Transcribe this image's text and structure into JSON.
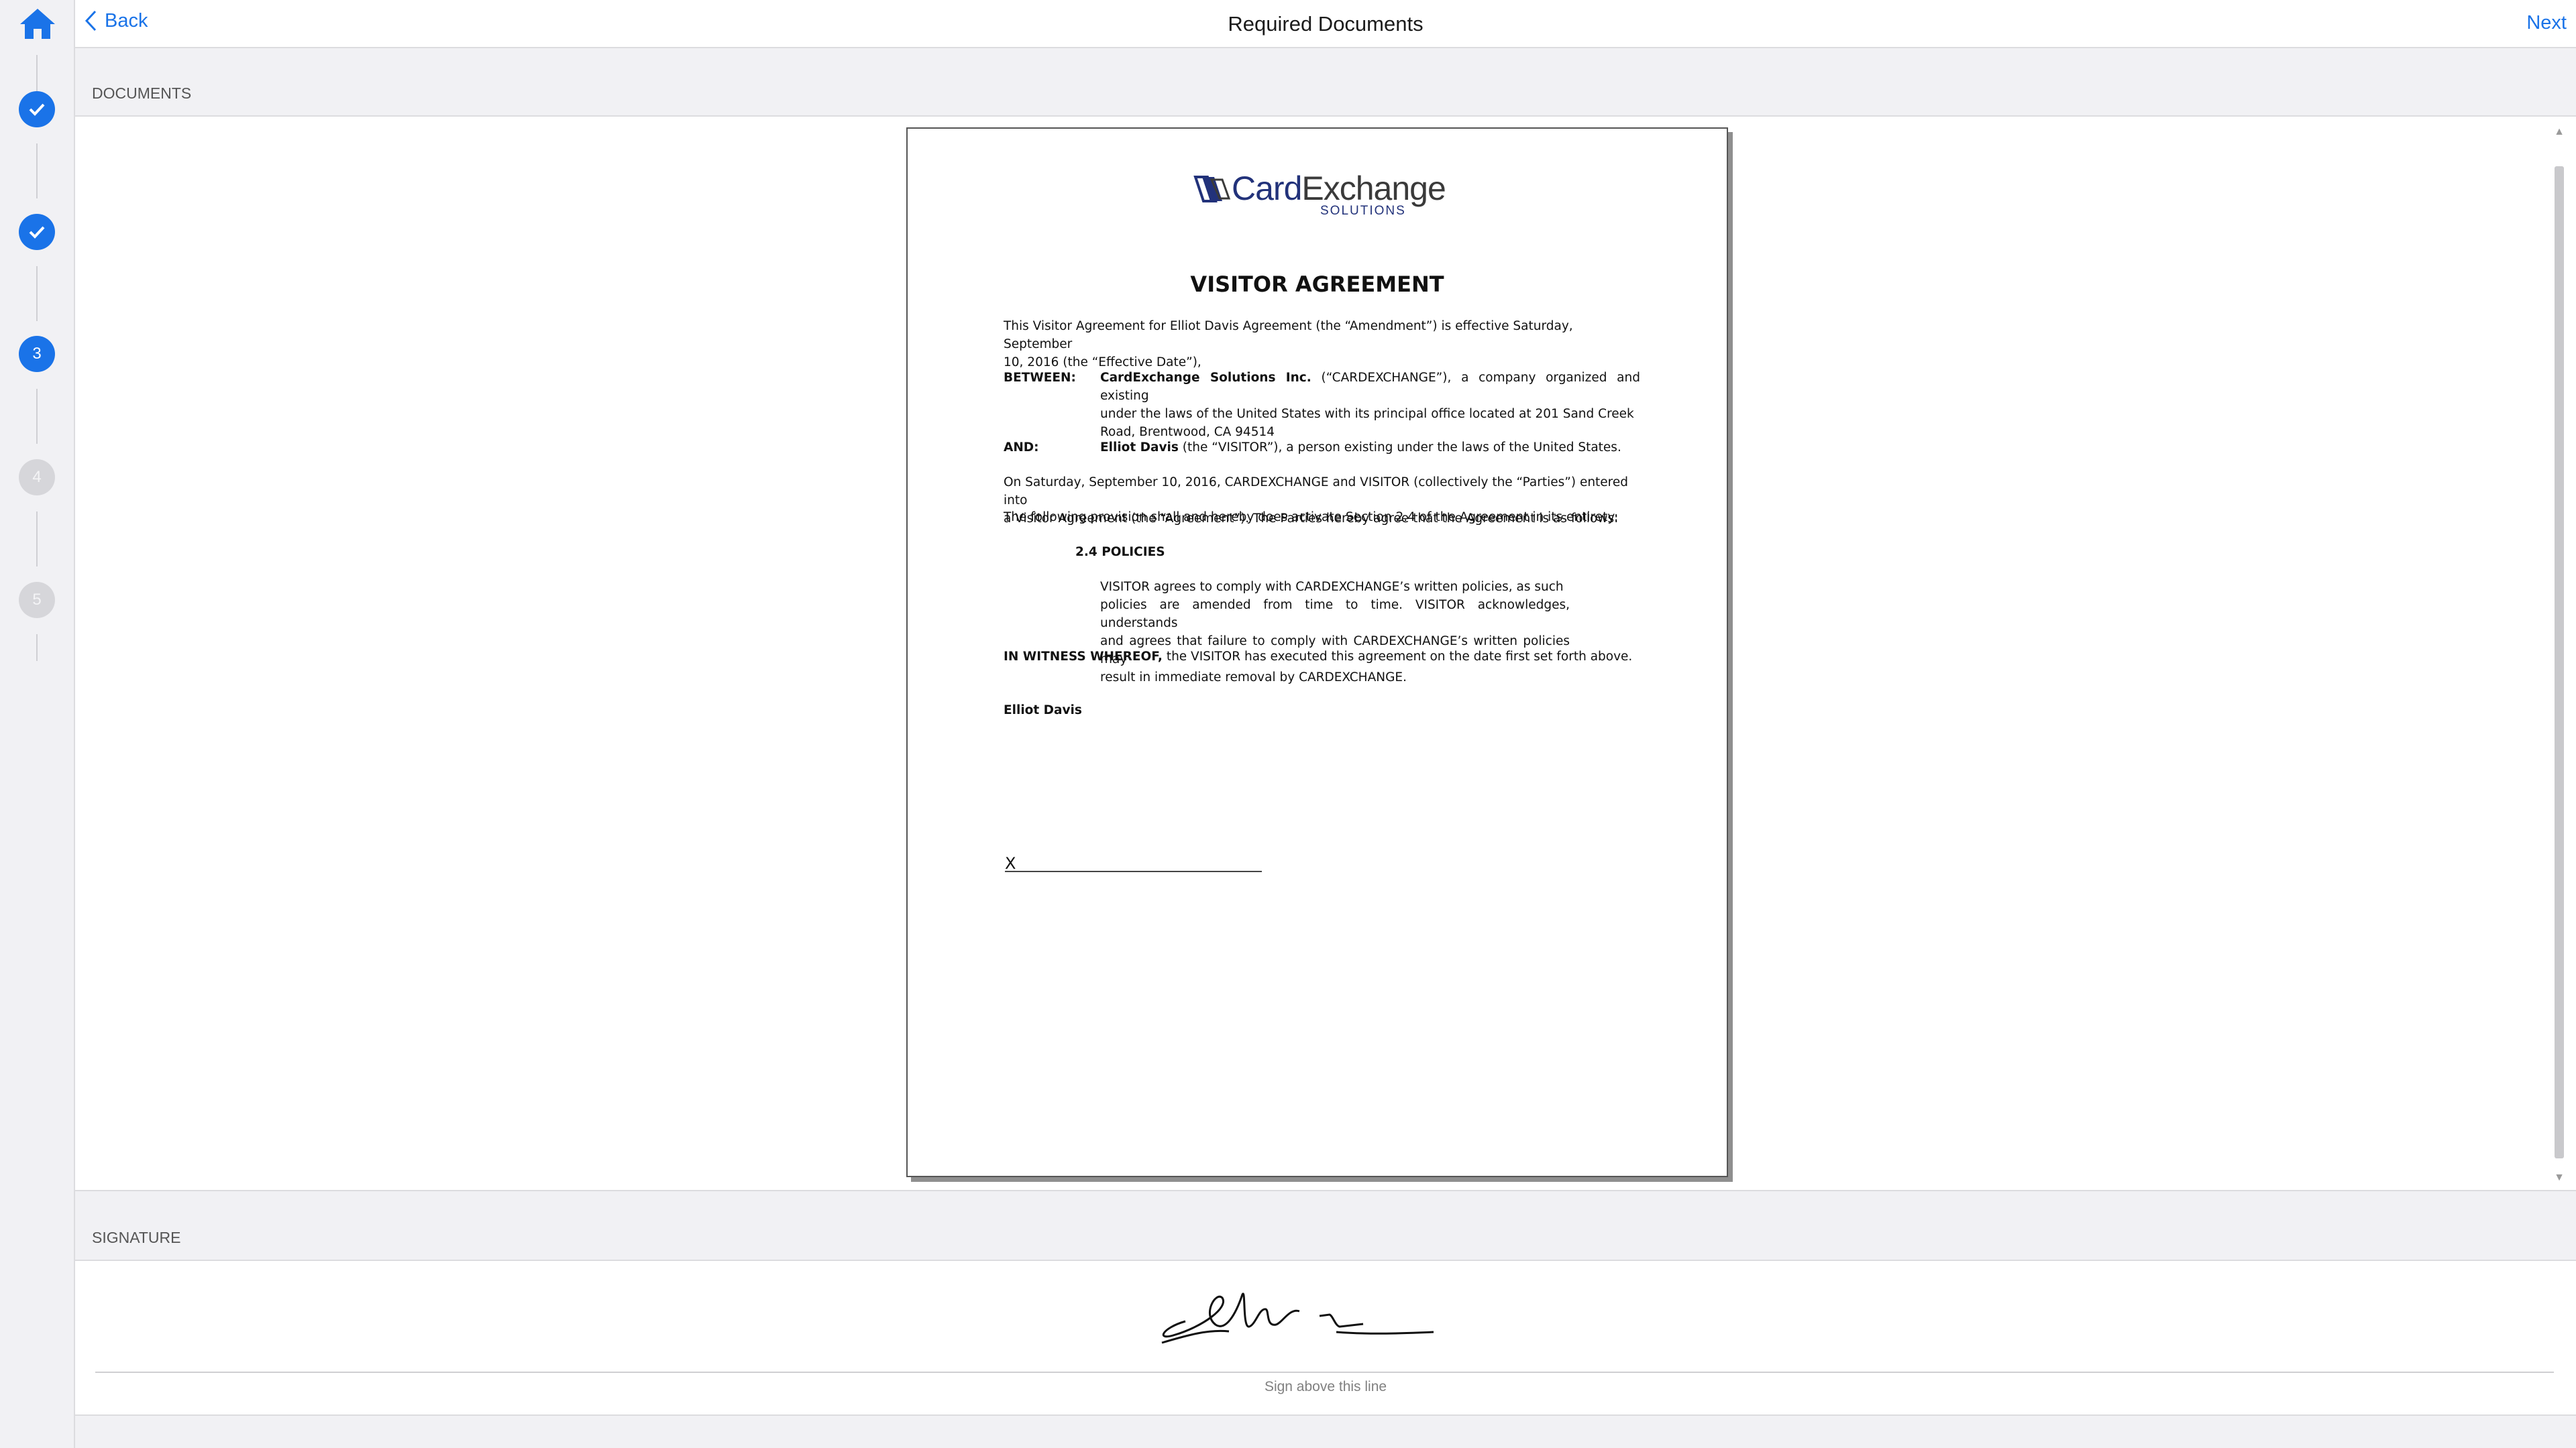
{
  "header": {
    "back_label": "Back",
    "title": "Required Documents",
    "next_label": "Next"
  },
  "steps": [
    {
      "state": "done",
      "label": ""
    },
    {
      "state": "done",
      "label": ""
    },
    {
      "state": "active",
      "label": "3"
    },
    {
      "state": "future",
      "label": "4"
    },
    {
      "state": "future",
      "label": "5"
    }
  ],
  "sections": {
    "documents": "DOCUMENTS",
    "signature": "SIGNATURE"
  },
  "document": {
    "logo_brand_1": "Card",
    "logo_brand_2": "Exchange",
    "logo_sub": "SOLUTIONS",
    "title": "VISITOR AGREEMENT",
    "intro_1": "This Visitor Agreement for Elliot Davis Agreement (the “Amendment”) is effective Saturday, September",
    "intro_2": "10, 2016 (the “Effective Date”),",
    "between_label": "BETWEEN:",
    "between_company": "CardExchange Solutions Inc.",
    "between_text_1": " (“CARDEXCHANGE”), a company organized and existing",
    "between_text_2": "under the laws of the United States with its principal office located at 201 Sand Creek",
    "between_text_3": "Road, Brentwood, CA 94514",
    "and_label": "AND:",
    "and_name": "Elliot Davis",
    "and_text": " (the “VISITOR”), a person existing under the laws of the United States.",
    "parties_1": "On Saturday, September 10, 2016, CARDEXCHANGE and VISITOR (collectively the “Parties”) entered into",
    "parties_2": "a Visitor Agreement (the “Agreement”).  The Parties hereby agree that the Agreement is as follows:",
    "provision": "The following provision shall and hereby does activate Section 2.4 of the Agreement in its entirety:",
    "section_heading": "2.4  POLICIES",
    "policy_1": "VISITOR agrees to comply with CARDEXCHANGE’s written policies, as such",
    "policy_2": "policies are amended from time to time. VISITOR acknowledges, understands",
    "policy_3": "and agrees that failure to comply with CARDEXCHANGE’s written policies may",
    "policy_4": "result in immediate removal by CARDEXCHANGE.",
    "witness_bold": "IN WITNESS WHEREOF,",
    "witness_text": " the VISITOR has executed this agreement on the date first set forth above.",
    "signer_name": "Elliot Davis",
    "sign_x": "X"
  },
  "signature_pad": {
    "hint": "Sign above this line"
  },
  "colors": {
    "accent": "#1a73e8",
    "logo_navy": "#22327a"
  }
}
